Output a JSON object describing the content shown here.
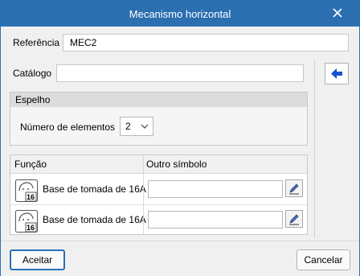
{
  "window": {
    "title": "Mecanismo horizontal",
    "close_icon": "close-icon"
  },
  "referencia": {
    "label": "Referência",
    "value": "MEC2"
  },
  "catalogo": {
    "label": "Catálogo",
    "value": ""
  },
  "espelho": {
    "header": "Espelho",
    "num_elementos_label": "Número de elementos",
    "num_elementos_value": "2"
  },
  "table": {
    "headers": {
      "funcao": "Função",
      "outro_simbolo": "Outro símbolo"
    },
    "rows": [
      {
        "label": "Base de tomada de 16A",
        "icon_text": "16",
        "outro_simbolo": ""
      },
      {
        "label": "Base de tomada de 16A",
        "icon_text": "16",
        "outro_simbolo": ""
      }
    ]
  },
  "footer": {
    "accept": "Aceitar",
    "cancel": "Cancelar"
  },
  "colors": {
    "title_bar": "#2b6fb1",
    "accent": "#2a6fb5",
    "arrow": "#1a4fd0"
  }
}
